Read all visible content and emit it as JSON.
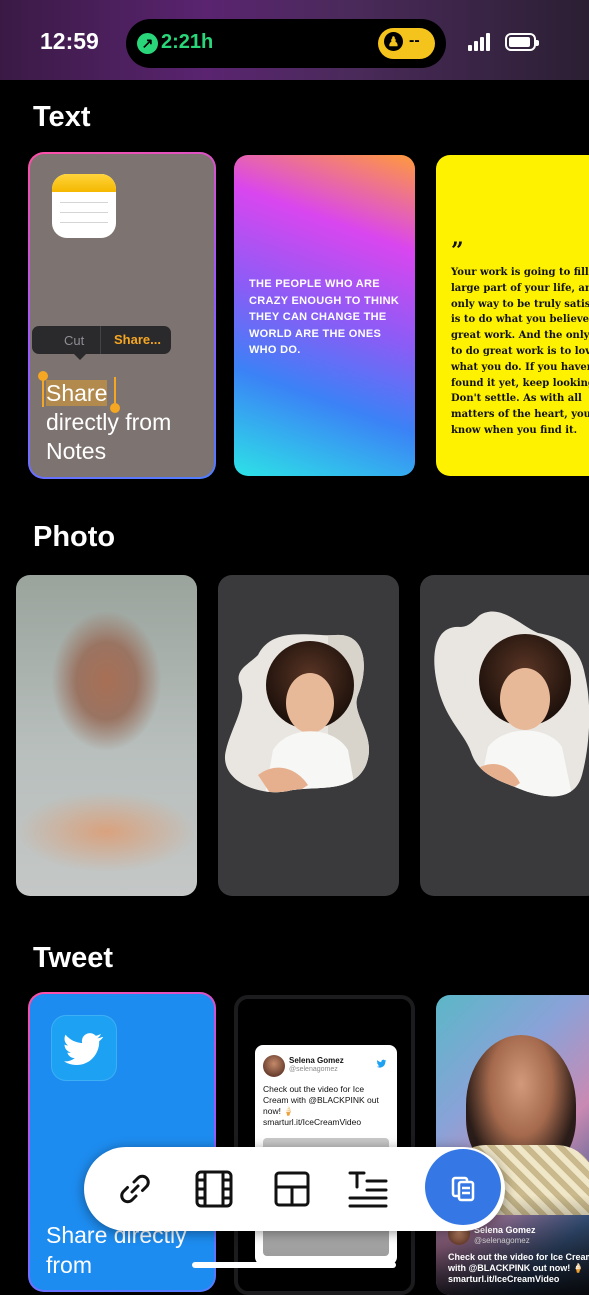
{
  "status_bar": {
    "time": "12:59",
    "activity_duration": "2:21h",
    "activity_value": "--"
  },
  "sections": {
    "text": "Text",
    "photo": "Photo",
    "tweet": "Tweet"
  },
  "text_cards": {
    "notes": {
      "menu_cut": "Cut",
      "menu_share": "Share...",
      "caption_selected": "Share",
      "caption_rest": "directly from Notes"
    },
    "gradient_quote": "THE PEOPLE WHO ARE CRAZY ENOUGH TO THINK THEY CAN CHANGE THE WORLD ARE THE ONES WHO DO.",
    "yellow_quote_mark": "”",
    "yellow_quote": "Your work is going to fill a large part of your life, and the only way to be truly satisfied is to do what you believe is great work. And the only way to do great work is to love what you do. If you haven't found it yet, keep looking. Don't settle. As with all matters of the heart, you'll know when you find it."
  },
  "tweet_cards": {
    "twitter_caption": "Share directly from",
    "tweet": {
      "name": "Selena Gomez",
      "handle": "@selenagomez",
      "body": "Check out the video for Ice Cream with @BLACKPINK out now! 🍦 smarturl.it/IceCreamVideo"
    },
    "overlay": {
      "name": "Selena Gomez",
      "handle": "@selenagomez",
      "body": "Check out the video for Ice Cream with @BLACKPINK out now! 🍦 smarturl.it/IceCreamVideo"
    }
  },
  "toolbar": {
    "items": [
      "link-icon",
      "film-icon",
      "layout-icon",
      "text-format-icon",
      "clipboard-icon"
    ]
  },
  "colors": {
    "accent": "#3578e5",
    "highlight": "#f5a623",
    "twitter": "#1da1f2",
    "activity_green": "#29d67a",
    "activity_yellow": "#f5c41c"
  }
}
